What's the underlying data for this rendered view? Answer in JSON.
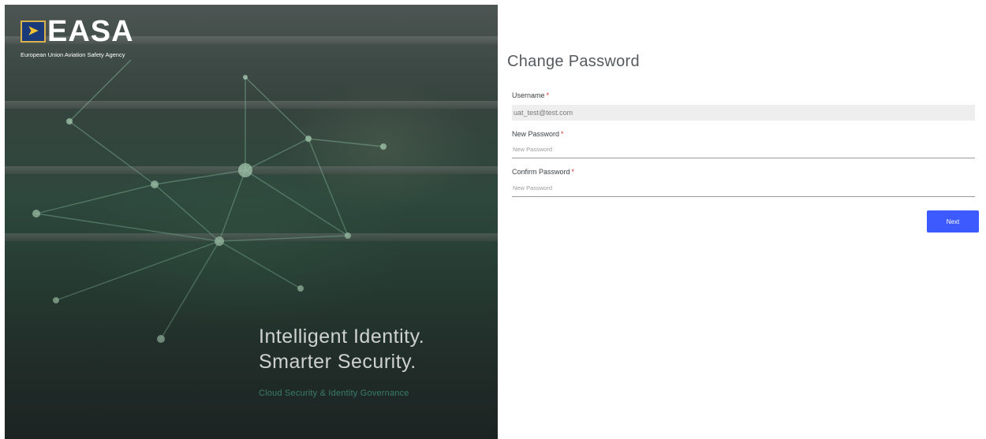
{
  "hero": {
    "logo_text": "EASA",
    "logo_subtitle": "European Union Aviation Safety Agency",
    "tagline_line1": "Intelligent Identity.",
    "tagline_line2": "Smarter Security.",
    "subtagline": "Cloud Security & Identity Governance"
  },
  "form": {
    "title": "Change Password",
    "required_marker": "*",
    "username": {
      "label": "Username",
      "value": "uat_test@test.com"
    },
    "new_password": {
      "label": "New Password",
      "placeholder": "New Password"
    },
    "confirm_password": {
      "label": "Confirm Password",
      "placeholder": "New Password"
    },
    "next_label": "Next"
  },
  "colors": {
    "accent": "#3d5afe",
    "required": "#d93025"
  }
}
